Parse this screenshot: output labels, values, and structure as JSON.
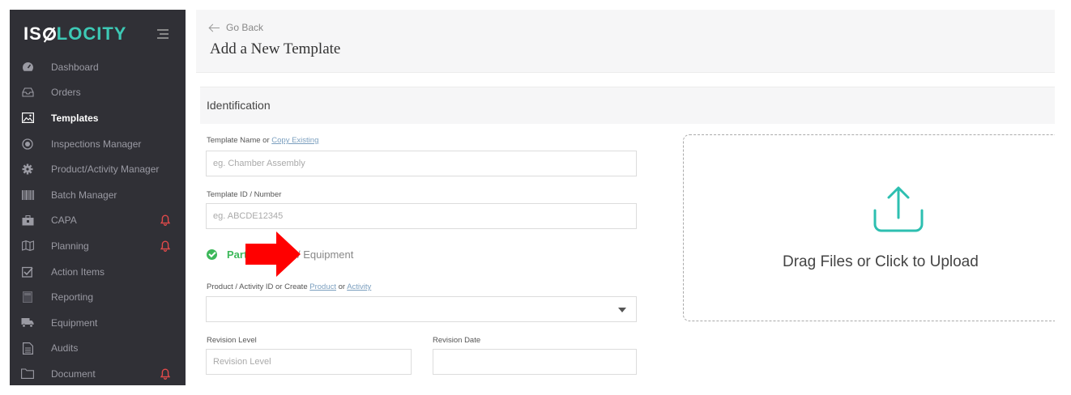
{
  "brand": {
    "logo_prefix": "IS",
    "logo_suffix": "LOCITY"
  },
  "sidebar": {
    "items": [
      {
        "label": "Dashboard",
        "icon": "dashboard-icon",
        "active": false,
        "alert": false
      },
      {
        "label": "Orders",
        "icon": "inbox-icon",
        "active": false,
        "alert": false
      },
      {
        "label": "Templates",
        "icon": "image-icon",
        "active": true,
        "alert": false
      },
      {
        "label": "Inspections Manager",
        "icon": "target-icon",
        "active": false,
        "alert": false
      },
      {
        "label": "Product/Activity Manager",
        "icon": "gear-icon",
        "active": false,
        "alert": false
      },
      {
        "label": "Batch Manager",
        "icon": "barcode-icon",
        "active": false,
        "alert": false
      },
      {
        "label": "CAPA",
        "icon": "briefcase-icon",
        "active": false,
        "alert": true
      },
      {
        "label": "Planning",
        "icon": "map-icon",
        "active": false,
        "alert": true
      },
      {
        "label": "Action Items",
        "icon": "checkbox-icon",
        "active": false,
        "alert": false
      },
      {
        "label": "Reporting",
        "icon": "calculator-icon",
        "active": false,
        "alert": false
      },
      {
        "label": "Equipment",
        "icon": "truck-icon",
        "active": false,
        "alert": false
      },
      {
        "label": "Audits",
        "icon": "document-icon",
        "active": false,
        "alert": false
      },
      {
        "label": "Document",
        "icon": "folder-icon",
        "active": false,
        "alert": true
      }
    ]
  },
  "header": {
    "back_label": "Go Back",
    "title": "Add a New Template"
  },
  "section": {
    "title": "Identification"
  },
  "form": {
    "template_name": {
      "label_prefix": "Template Name or ",
      "label_link": "Copy Existing",
      "placeholder": "eg. Chamber Assembly"
    },
    "template_id": {
      "label": "Template ID / Number",
      "placeholder": "eg. ABCDE12345"
    },
    "type_toggle": {
      "part_label": "Part",
      "equipment_label": "/ Equipment"
    },
    "product": {
      "label_prefix": "Product / Activity ID or Create ",
      "link_product": "Product",
      "label_or": " or ",
      "link_activity": "Activity",
      "value": ""
    },
    "revision_level": {
      "label": "Revision Level",
      "placeholder": "Revision Level"
    },
    "revision_date": {
      "label": "Revision Date",
      "value": ""
    }
  },
  "upload": {
    "label": "Drag Files or Click to Upload",
    "icon": "upload-icon"
  },
  "colors": {
    "sidebar_bg": "#303036",
    "accent": "#3dc9b5",
    "success": "#3db85a",
    "alert": "#e24a4a",
    "annotation_arrow": "#ff0000"
  }
}
